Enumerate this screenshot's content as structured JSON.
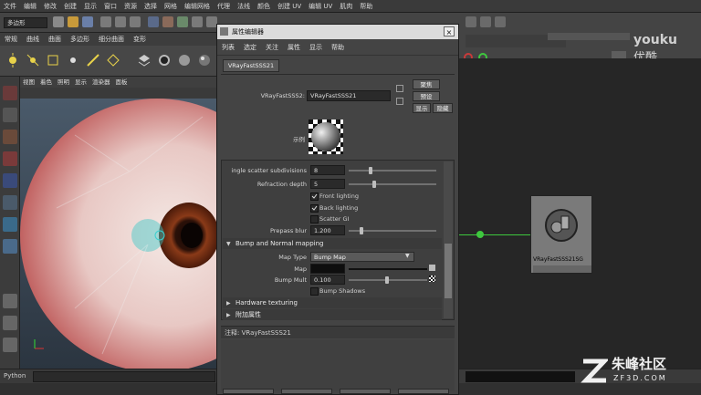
{
  "menubar": [
    "文件",
    "编辑",
    "修改",
    "创建",
    "显示",
    "窗口",
    "资源",
    "选择",
    "网格",
    "编辑网格",
    "代理",
    "法线",
    "颜色",
    "创建 UV",
    "编辑 UV",
    "肌肉",
    "帮助"
  ],
  "status_line": {
    "mode_value": "多边形"
  },
  "shelf_tabs": [
    "常规",
    "曲线",
    "曲面",
    "多边形",
    "细分曲面",
    "变形"
  ],
  "viewport_menu": [
    "视图",
    "着色",
    "照明",
    "显示",
    "渲染器",
    "面板"
  ],
  "dialog": {
    "title": "属性编辑器",
    "menu": [
      "列表",
      "选定",
      "关注",
      "属性",
      "显示",
      "帮助"
    ],
    "tab": "VRayFastSSS21",
    "node_label": "VRayFastSSS2:",
    "node_name": "VRayFastSSS21",
    "btn_focus": "聚焦",
    "btn_preset": "预设",
    "btn_show": "显示",
    "btn_hide": "隐藏",
    "sample_label": "示例",
    "attrs": {
      "single_scatter_label": "ingle scatter subdivisions",
      "single_scatter_value": "8",
      "refraction_label": "Refraction depth",
      "refraction_value": "5",
      "front_lighting": "Front lighting",
      "back_lighting": "Back lighting",
      "scatter_gi": "Scatter GI",
      "prepass_label": "Prepass blur",
      "prepass_value": "1.200"
    },
    "bump_section": "Bump and Normal mapping",
    "bump": {
      "map_type_label": "Map Type",
      "map_type_value": "Bump Map",
      "map_label": "Map",
      "bump_mult_label": "Bump Mult",
      "bump_mult_value": "0.100",
      "bump_shadows": "Bump Shadows"
    },
    "hw_section": "Hardware texturing",
    "extra_section": "附加属性",
    "notes": "注释: VRayFastSSS21"
  },
  "node_graph": {
    "node_label": "VRayFastSSS21SG"
  },
  "cmd_label": "Python",
  "watermark": {
    "brand": "youku",
    "brand_cn": "优酷",
    "logo_cn": "朱峰社区",
    "logo_url": "ZF3D.COM"
  },
  "colors": {
    "eye_red": "#b84a4a",
    "iris": "#6b2a12",
    "accent_green": "#3ec83e"
  }
}
